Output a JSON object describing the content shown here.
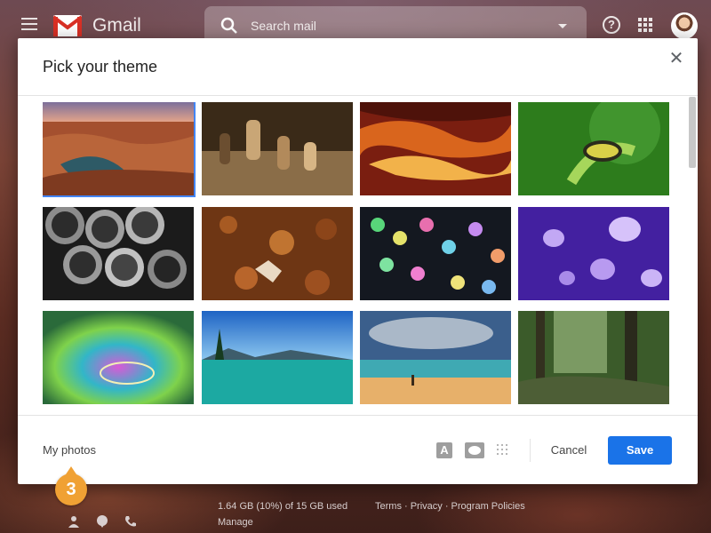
{
  "topbar": {
    "app_name": "Gmail",
    "search_placeholder": "Search mail",
    "help_glyph": "?"
  },
  "dialog": {
    "title": "Pick your theme",
    "close_glyph": "✕",
    "themes": [
      {
        "name": "canyon",
        "selected": true
      },
      {
        "name": "chess"
      },
      {
        "name": "antelope-canyon"
      },
      {
        "name": "caterpillar"
      },
      {
        "name": "pipes"
      },
      {
        "name": "autumn-leaves"
      },
      {
        "name": "bokeh-lights"
      },
      {
        "name": "jellyfish"
      },
      {
        "name": "iridescent-water"
      },
      {
        "name": "lake-tahoe"
      },
      {
        "name": "beach"
      },
      {
        "name": "forest"
      }
    ],
    "my_photos_label": "My photos",
    "text_icon_glyph": "A",
    "cancel_label": "Cancel",
    "save_label": "Save"
  },
  "footer": {
    "storage": "1.64 GB (10%) of 15 GB used",
    "manage": "Manage",
    "links": "Terms · Privacy · Program Policies"
  },
  "step_badge": "3",
  "colors": {
    "accent": "#1a73e8",
    "selection": "#4285f4",
    "badge": "#f0a134"
  }
}
